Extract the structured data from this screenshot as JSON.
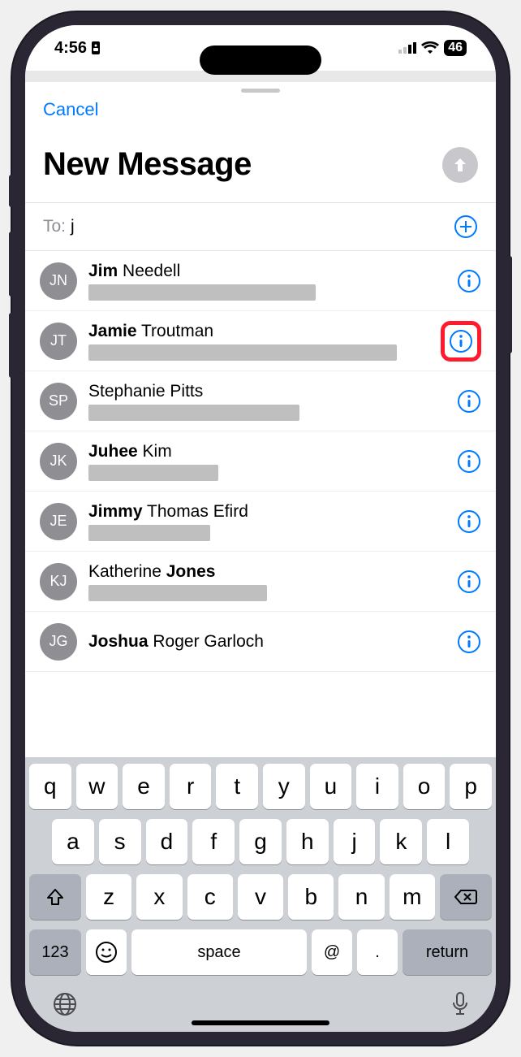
{
  "status": {
    "time": "4:56",
    "battery": "46"
  },
  "nav": {
    "cancel": "Cancel"
  },
  "compose": {
    "title": "New Message",
    "to_label": "To:",
    "to_value": "j"
  },
  "contacts": [
    {
      "initials": "JN",
      "bold": "Jim",
      "rest": " Needell",
      "redactW": 280,
      "highlight": false
    },
    {
      "initials": "JT",
      "bold": "Jamie",
      "rest": " Troutman",
      "redactW": 380,
      "highlight": true
    },
    {
      "initials": "SP",
      "bold": "",
      "rest": "Stephanie Pitts",
      "redactW": 260,
      "highlight": false
    },
    {
      "initials": "JK",
      "bold": "Juhee",
      "rest": " Kim",
      "redactW": 160,
      "highlight": false
    },
    {
      "initials": "JE",
      "bold": "Jimmy",
      "rest": " Thomas Efird",
      "redactW": 150,
      "highlight": false
    },
    {
      "initials": "KJ",
      "bold": "Jones",
      "rest": "Katherine ",
      "swap": true,
      "redactW": 220,
      "highlight": false
    },
    {
      "initials": "JG",
      "bold": "Joshua",
      "rest": " Roger Garloch",
      "redactW": 0,
      "highlight": false
    }
  ],
  "keyboard": {
    "rows": [
      [
        "q",
        "w",
        "e",
        "r",
        "t",
        "y",
        "u",
        "i",
        "o",
        "p"
      ],
      [
        "a",
        "s",
        "d",
        "f",
        "g",
        "h",
        "j",
        "k",
        "l"
      ],
      [
        "z",
        "x",
        "c",
        "v",
        "b",
        "n",
        "m"
      ]
    ],
    "num": "123",
    "space": "space",
    "at": "@",
    "dot": ".",
    "ret": "return"
  }
}
